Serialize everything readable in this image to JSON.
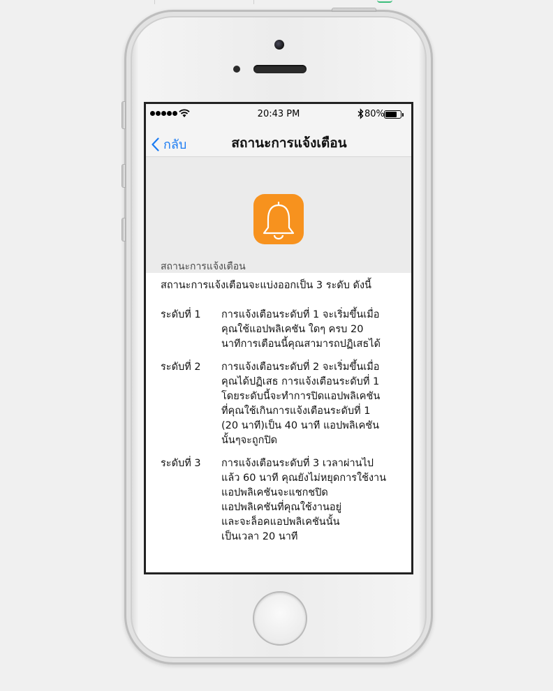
{
  "status_bar": {
    "time": "20:43 PM",
    "battery_percent": "80%",
    "signal_icon": "signal-dots-icon",
    "wifi_icon": "wifi-icon",
    "bluetooth_icon": "bluetooth-icon",
    "battery_level": 0.8
  },
  "nav": {
    "back_label": "กลับ",
    "title": "สถานะการแจ้งเตือน"
  },
  "hero": {
    "icon": "bell-icon",
    "icon_bg": "#f7921e",
    "section_label": "สถานะการแจ้งเตือน"
  },
  "content": {
    "intro": "สถานะการแจ้งเตือนจะแบ่งออกเป็น 3 ระดับ ดังนี้",
    "levels": [
      {
        "name": "ระดับที่ 1",
        "description": "การแจ้งเตือนระดับที่ 1 จะเริ่มขึ้นเมื่อ\nคุณใช้แอปพลิเคชัน ใดๆ ครบ 20\nนาทีการเตือนนี้คุณสามารถปฏิเสธได้"
      },
      {
        "name": "ระดับที่ 2",
        "description": "การแจ้งเตือนระดับที่ 2 จะเริ่มขึ้นเมื่อ\nคุณได้ปฏิเสธ การแจ้งเตือนระดับที่ 1\nโดยระดับนี้จะทำการปิดแอปพลิเคชัน\nที่คุณใช้เกินการแจ้งเตือนระดับที่ 1\n(20 นาที)เป็น 40 นาที แอปพลิเคชัน\nนั้นๆจะถูกปิด"
      },
      {
        "name": "ระดับที่ 3",
        "description": "การแจ้งเตือนระดับที่ 3 เวลาผ่านไป\nแล้ว 60 นาที คุณยังไม่หยุดการใช้งาน\nแอปพลิเคชันจะแชกชปิด\nแอปพลิเคชันที่คุณใช้งานอยู่\nและจะล็อคแอปพลิเคชันนั้น\nเป็นเวลา 20 นาที"
      }
    ]
  },
  "colors": {
    "accent": "#1a7bf2",
    "app_icon": "#f7921e"
  }
}
